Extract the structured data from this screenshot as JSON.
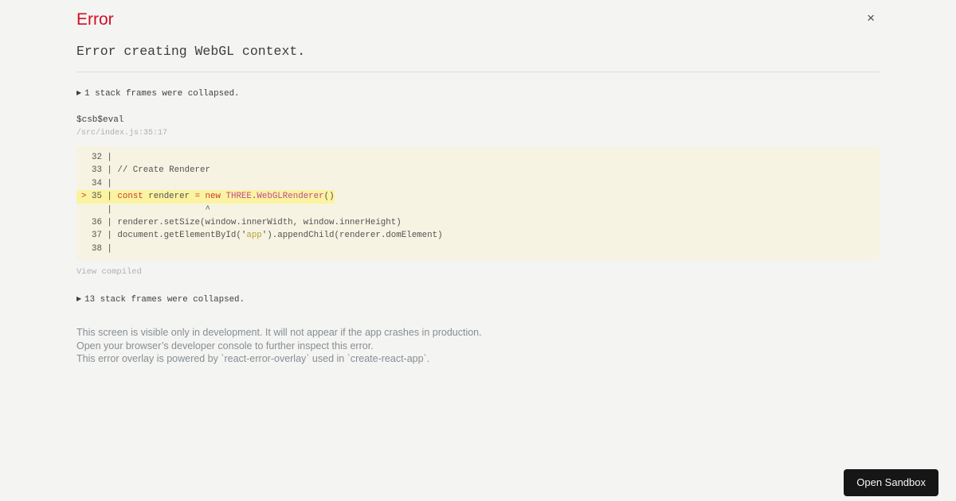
{
  "page": {
    "background_color": "#f4f4f3"
  },
  "header": {
    "title": "Error",
    "title_color": "#ce1126",
    "close_icon": "×"
  },
  "error": {
    "message": "Error creating WebGL context."
  },
  "stack": {
    "arrow_icon": "▶",
    "collapsed_top": "1 stack frames were collapsed.",
    "frame": {
      "function": "$csb$eval",
      "location": "/src/index.js:35:17"
    },
    "view_compiled": "View compiled",
    "collapsed_bottom": "13 stack frames were collapsed."
  },
  "code": {
    "background_color": "#f7f3e3",
    "highlight_color": "#fbf3a1",
    "keyword_color": "#c93a2f",
    "class_color": "#bf4a92",
    "string_color": "#b2a338",
    "lines": [
      {
        "highlight": false,
        "segments": [
          {
            "t": "  32 | "
          }
        ]
      },
      {
        "highlight": false,
        "segments": [
          {
            "t": "  33 | // Create Renderer"
          }
        ]
      },
      {
        "highlight": false,
        "segments": [
          {
            "t": "  34 | "
          }
        ]
      },
      {
        "highlight": true,
        "segments": [
          {
            "t": "> ",
            "c": "red"
          },
          {
            "t": "35 | "
          },
          {
            "t": "const",
            "c": "red"
          },
          {
            "t": " renderer "
          },
          {
            "t": "=",
            "c": "red"
          },
          {
            "t": " "
          },
          {
            "t": "new",
            "c": "red"
          },
          {
            "t": " "
          },
          {
            "t": "THREE",
            "c": "magenta"
          },
          {
            "t": "."
          },
          {
            "t": "WebGLRenderer",
            "c": "magenta"
          },
          {
            "t": "()"
          }
        ]
      },
      {
        "highlight": false,
        "segments": [
          {
            "t": "     |                  ^"
          }
        ]
      },
      {
        "highlight": false,
        "segments": [
          {
            "t": "  36 | renderer.setSize(window.innerWidth, window.innerHeight)"
          }
        ]
      },
      {
        "highlight": false,
        "segments": [
          {
            "t": "  37 | document.getElementById('"
          },
          {
            "t": "app",
            "c": "olive"
          },
          {
            "t": "').appendChild(renderer.domElement)"
          }
        ]
      },
      {
        "highlight": false,
        "segments": [
          {
            "t": "  38 | "
          }
        ]
      }
    ]
  },
  "footer": {
    "lines": [
      "This screen is visible only in development. It will not appear if the app crashes in production.",
      "Open your browser’s developer console to further inspect this error.",
      "This error overlay is powered by `react-error-overlay` used in `create-react-app`."
    ]
  },
  "sandbox_button": {
    "label": "Open Sandbox"
  }
}
